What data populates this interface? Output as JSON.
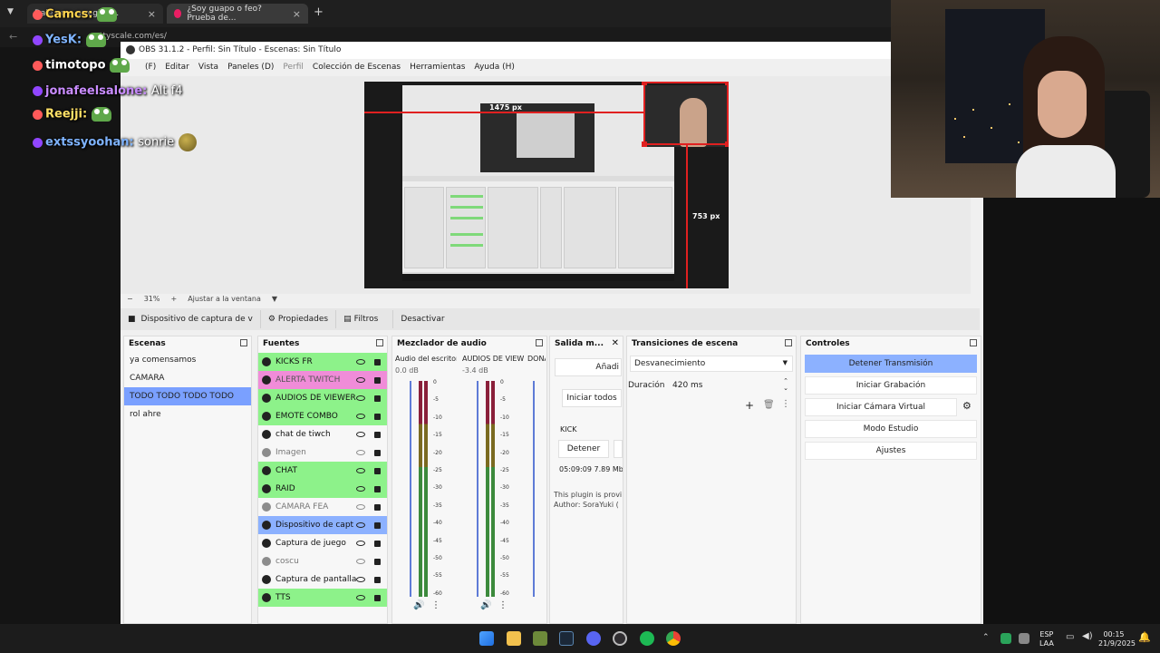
{
  "browser": {
    "tab1_title": "Dale pu... arreglar ...",
    "tab2_title": "¿Soy guapo o feo? Prueba de...",
    "address": "ttyscale.com/es/"
  },
  "chat": [
    {
      "user": "Camcs:",
      "msg": "",
      "color": "#ffd54f"
    },
    {
      "user": "YesK:",
      "msg": "",
      "color": "#7fb4ff"
    },
    {
      "user": "timotopo",
      "msg": "",
      "color": "#ffffff"
    },
    {
      "user": "jonafeelsalone:",
      "msg": "Alt f4",
      "color": "#c98cff"
    },
    {
      "user": "Reejji:",
      "msg": "",
      "color": "#ffe066"
    },
    {
      "user": "extssyoohan:",
      "msg": "sonrie",
      "color": "#7fb4ff"
    }
  ],
  "obs": {
    "title": "OBS 31.1.2 - Perfil: Sin Título - Escenas: Sin Título",
    "menu": [
      "(F)",
      "Editar",
      "Vista",
      "Paneles (D)",
      "Perfil",
      "Colección de Escenas",
      "Herramientas",
      "Ayuda (H)"
    ],
    "preview_labels": {
      "width": "1475 px",
      "height": "753 px"
    },
    "zoom": "31%",
    "fit_label": "Ajustar a la ventana",
    "source_toolbar": {
      "device": "Dispositivo de captura de v",
      "properties": "Propiedades",
      "filters": "Filtros",
      "deactivate": "Desactivar"
    },
    "scenes": {
      "title": "Escenas",
      "items": [
        "ya comensamos",
        "CAMARA",
        "TODO TODO TODO TODO",
        "rol ahre"
      ],
      "selected_index": 2
    },
    "sources": {
      "title": "Fuentes",
      "items": [
        {
          "label": "KICKS FR",
          "style": "green"
        },
        {
          "label": "ALERTA TWITCH",
          "style": "pink"
        },
        {
          "label": "AUDIOS DE VIEWER",
          "style": "green"
        },
        {
          "label": "EMOTE COMBO",
          "style": "green"
        },
        {
          "label": "chat de tiwch",
          "style": "plain"
        },
        {
          "label": "Imagen",
          "style": "dim"
        },
        {
          "label": "CHAT",
          "style": "green"
        },
        {
          "label": "RAID",
          "style": "green"
        },
        {
          "label": "CAMARA FEA",
          "style": "dim"
        },
        {
          "label": "Dispositivo de capt",
          "style": "blue"
        },
        {
          "label": "Captura de juego",
          "style": "plain"
        },
        {
          "label": "coscu",
          "style": "dim"
        },
        {
          "label": "Captura de pantalla",
          "style": "plain"
        },
        {
          "label": "TTS",
          "style": "green"
        }
      ]
    },
    "mixer": {
      "title": "Mezclador de audio",
      "channels": [
        {
          "name": "Audio del escritorio",
          "db": "0.0 dB"
        },
        {
          "name": "AUDIOS DE VIEWER",
          "db": "-3.4 dB"
        },
        {
          "name": "DONA",
          "db": ""
        }
      ],
      "ticks": [
        "0",
        "-5",
        "-10",
        "-15",
        "-20",
        "-25",
        "-30",
        "-35",
        "-40",
        "-45",
        "-50",
        "-55",
        "-60"
      ]
    },
    "output": {
      "title": "Salida m...",
      "add": "Añadi",
      "start_all": "Iniciar todos",
      "service": "KICK",
      "stop": "Detener",
      "stats": "05:09:09  7.89 Mb",
      "plugin_line1": "This plugin is provi",
      "plugin_line2": "Author: SoraYuki ("
    },
    "transitions": {
      "title": "Transiciones de escena",
      "selected": "Desvanecimiento",
      "duration_label": "Duración",
      "duration_value": "420 ms"
    },
    "controls": {
      "title": "Controles",
      "buttons": [
        "Detener Transmisión",
        "Iniciar Grabación",
        "Iniciar Cámara Virtual",
        "Modo Estudio",
        "Ajustes"
      ]
    }
  },
  "taskbar": {
    "lang1": "ESP",
    "lang2": "LAA",
    "time": "00:15",
    "date": "21/9/2025"
  }
}
